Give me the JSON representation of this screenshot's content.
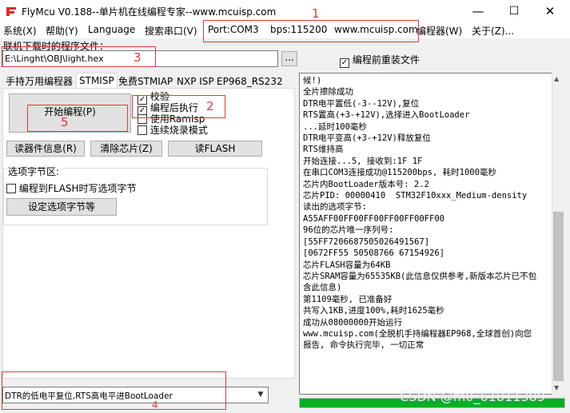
{
  "window": {
    "title": "FlyMcu V0.188--单片机在线编程专家--www.mcuisp.com",
    "minimize": "—",
    "maximize": "☐",
    "close": "✕"
  },
  "menu": {
    "items": [
      "系统(X)",
      "帮助(Y)",
      "Language",
      "搜索串口(V)",
      "Port:COM3",
      "bps:115200",
      "www.mcuisp.com",
      "编程器(W)",
      "关于(Z)..."
    ]
  },
  "annotations": [
    "1",
    "2",
    "3",
    "4",
    "5"
  ],
  "file": {
    "label": "联机下载时的程序文件：",
    "path": "E:\\Linght\\OBJ\\light.hex",
    "browse_label": "...",
    "reload_label": "编程前重装文件",
    "reload_checked": true
  },
  "tabs": [
    "手持万用编程器",
    "STMISP",
    "免费STMIAP",
    "NXP ISP",
    "EP968_RS232"
  ],
  "stmisp": {
    "start_button": "开始编程(P)",
    "options": [
      {
        "label": "校验",
        "checked": true
      },
      {
        "label": "编程后执行",
        "checked": true
      },
      {
        "label": "使用RamIsp",
        "checked": false
      },
      {
        "label": "连续烧录模式",
        "checked": false
      }
    ],
    "read_info": "读器件信息(R)",
    "erase_chip": "清除芯片(Z)",
    "read_flash": "读FLASH",
    "option_section_label": "选项字节区:",
    "write_option_label": "编程到FLASH时写选项字节",
    "set_option_button": "设定选项字节等"
  },
  "bottom": {
    "dtr_select": "DTR的低电平复位,RTS高电平进BootLoader"
  },
  "log": [
    "候!)",
    "全片擦除成功",
    "DTR电平置低(-3--12V),复位",
    "RTS置高(+3-+12V),选择进入BootLoader",
    "...延时100毫秒",
    "DTR电平变高(+3-+12V)释放复位",
    "RTS维持高",
    "开始连接...5, 接收到:1F 1F",
    "在串口COM3连接成功@115200bps, 耗时1000毫秒",
    "芯片内BootLoader版本号: 2.2",
    "芯片PID: 00000410  STM32F10xxx_Medium-density",
    "读出的选项字节:",
    "A55AFF00FF00FF00FF00FF00FF00",
    "96位的芯片唯一序列号:",
    "[55FF7206687505026491567]",
    "[0672FF55 50508766 67154926]",
    "芯片FLASH容量为64KB",
    "芯片SRAM容量为65535KB(此信息仅供参考,新版本芯片已不包含此信息)",
    "第1109毫秒, 已准备好",
    "共写入1KB,进度100%,耗时1625毫秒",
    "成功从08000000开始运行",
    "www.mcuisp.com(全脱机手持编程器EP968,全球首创)向您报告, 命令执行完毕, 一切正常"
  ],
  "watermark": "CSDN @m0_61811389",
  "colors": {
    "annotation": "#e03a3a",
    "progress": "#06b025"
  }
}
